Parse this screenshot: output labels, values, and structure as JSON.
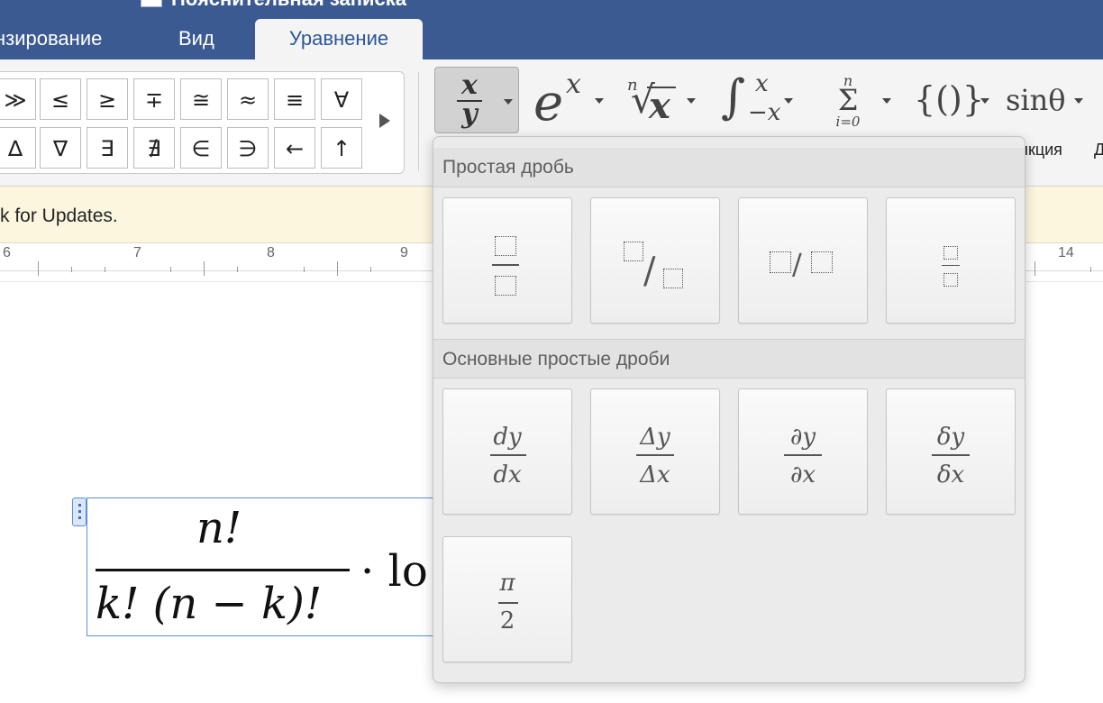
{
  "window": {
    "title": "Пояснительная записка"
  },
  "tabs": [
    {
      "label": "нзирование"
    },
    {
      "label": "Вид"
    },
    {
      "label": "Уравнение",
      "active": true
    }
  ],
  "symbols": {
    "row1": [
      "≫",
      "≤",
      "≥",
      "∓",
      "≅",
      "≈",
      "≡",
      "∀"
    ],
    "row2": [
      "∆",
      "∇",
      "∃",
      "∄",
      "∈",
      "∋",
      "←",
      "↑"
    ]
  },
  "ribbon": {
    "fraction": {
      "num": "x",
      "den": "y"
    },
    "script": {
      "base": "e",
      "sup": "x"
    },
    "radical": {
      "index": "n",
      "radicand": "x"
    },
    "integral": {
      "sign": "∫",
      "upper": "x",
      "lower": "−x"
    },
    "large_operator": {
      "sign": "Σ",
      "upper": "n",
      "lower": "i=0"
    },
    "bracket": {
      "label": "{()}"
    },
    "function": {
      "label": "sinθ",
      "caption": "ункция"
    },
    "next_caption": "Д"
  },
  "notification": {
    "text": "k for Updates."
  },
  "ruler": {
    "labels": [
      "6",
      "7",
      "8",
      "9",
      "14"
    ]
  },
  "equation": {
    "numerator": "n!",
    "denominator": "k! (n − k)!",
    "tail": "· lo"
  },
  "dropdown": {
    "section1": {
      "title": "Простая дробь"
    },
    "section2": {
      "title": "Основные простые дроби"
    },
    "common_fractions": [
      {
        "num": "dy",
        "den": "dx"
      },
      {
        "num": "Δy",
        "den": "Δx"
      },
      {
        "num": "∂y",
        "den": "∂x"
      },
      {
        "num": "δy",
        "den": "δx"
      },
      {
        "num": "π",
        "den": "2"
      }
    ],
    "stacked_slash_separator": "/",
    "linear_separator": "/"
  },
  "colors": {
    "titlebar": "#3c5a92",
    "active_tab_text": "#2b579a",
    "notification_bg": "#fdf6df",
    "equation_border": "#5b8fd6"
  }
}
